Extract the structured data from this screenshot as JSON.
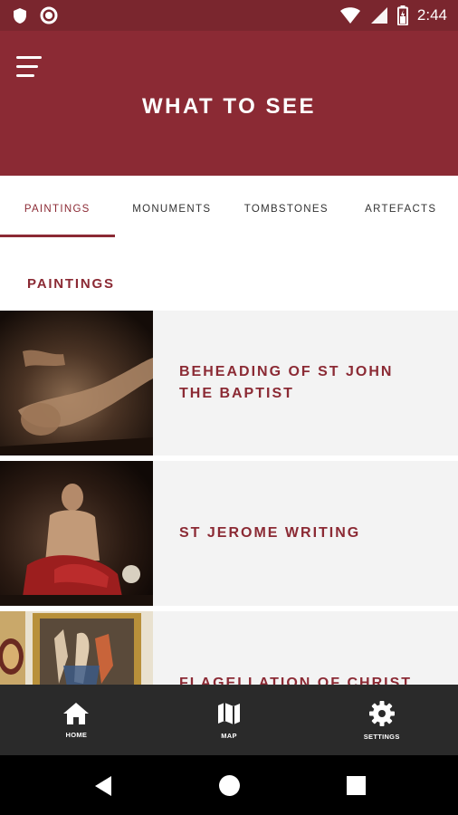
{
  "status_bar": {
    "time": "2:44",
    "icons": [
      "shield-icon",
      "circle-icon",
      "wifi-icon",
      "signal-icon",
      "battery-icon"
    ]
  },
  "app_bar": {
    "title": "WHAT TO SEE",
    "menu_icon": "hamburger-menu-icon",
    "background": "#8b2a34"
  },
  "tabs": [
    {
      "label": "PAINTINGS",
      "active": true
    },
    {
      "label": "MONUMENTS",
      "active": false
    },
    {
      "label": "TOMBSTONES",
      "active": false
    },
    {
      "label": "ARTEFACTS",
      "active": false
    }
  ],
  "section": {
    "heading": "PAINTINGS"
  },
  "items": [
    {
      "title": "BEHEADING OF ST JOHN THE BAPTIST"
    },
    {
      "title": "ST JEROME WRITING"
    },
    {
      "title": "FLAGELLATION OF CHRIST"
    }
  ],
  "bottom_nav": [
    {
      "label": "HOME",
      "icon": "home-icon"
    },
    {
      "label": "MAP",
      "icon": "map-icon"
    },
    {
      "label": "SETTINGS",
      "icon": "gear-icon"
    }
  ],
  "colors": {
    "accent": "#8b2a34",
    "status_bar": "#7a262e",
    "list_bg": "#f3f3f3",
    "bottom_nav": "#2a2a2a"
  }
}
